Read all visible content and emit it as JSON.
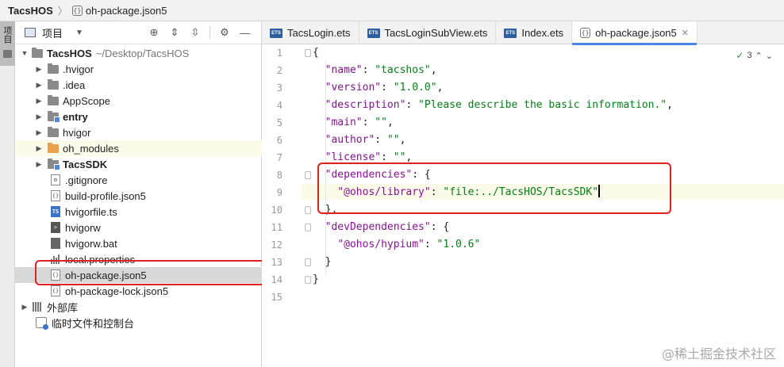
{
  "breadcrumb": {
    "root": "TacsHOS",
    "file": "oh-package.json5"
  },
  "stripe": {
    "label": "项目"
  },
  "project_panel": {
    "title": "项目"
  },
  "tree": [
    {
      "label": "TacsHOS",
      "extra": "~/Desktop/TacsHOS",
      "bold": true
    },
    {
      "label": ".hvigor"
    },
    {
      "label": ".idea"
    },
    {
      "label": "AppScope"
    },
    {
      "label": "entry",
      "bold": true
    },
    {
      "label": "hvigor"
    },
    {
      "label": "oh_modules"
    },
    {
      "label": "TacsSDK",
      "bold": true
    },
    {
      "label": ".gitignore"
    },
    {
      "label": "build-profile.json5"
    },
    {
      "label": "hvigorfile.ts"
    },
    {
      "label": "hvigorw"
    },
    {
      "label": "hvigorw.bat"
    },
    {
      "label": "local.properties"
    },
    {
      "label": "oh-package.json5"
    },
    {
      "label": "oh-package-lock.json5"
    },
    {
      "label": "外部库"
    },
    {
      "label": "临时文件和控制台"
    }
  ],
  "tabs": [
    {
      "label": "TacsLogin.ets",
      "icon": "ETS"
    },
    {
      "label": "TacsLoginSubView.ets",
      "icon": "ETS"
    },
    {
      "label": "Index.ets",
      "icon": "ETS"
    },
    {
      "label": "oh-package.json5",
      "icon": "{}"
    }
  ],
  "inspection": {
    "count": "3"
  },
  "line_numbers": [
    "1",
    "2",
    "3",
    "4",
    "5",
    "6",
    "7",
    "8",
    "9",
    "10",
    "11",
    "12",
    "13",
    "14",
    "15"
  ],
  "code": {
    "l1": "{",
    "l2_key": "\"name\"",
    "l2_val": "\"tacshos\"",
    "l3_key": "\"version\"",
    "l3_val": "\"1.0.0\"",
    "l4_key": "\"description\"",
    "l4_val": "\"Please describe the basic information.\"",
    "l5_key": "\"main\"",
    "l5_val": "\"\"",
    "l6_key": "\"author\"",
    "l6_val": "\"\"",
    "l7_key": "\"license\"",
    "l7_val": "\"\"",
    "l8_key": "\"dependencies\"",
    "l9_key": "\"@ohos/library\"",
    "l9_val": "\"file:../TacsHOS/TacsSDK\"",
    "l10": "},",
    "l11_key": "\"devDependencies\"",
    "l12_key": "\"@ohos/hypium\"",
    "l12_val": "\"1.0.6\"",
    "l13": "}",
    "l14": "}"
  },
  "watermark": "@稀土掘金技术社区"
}
